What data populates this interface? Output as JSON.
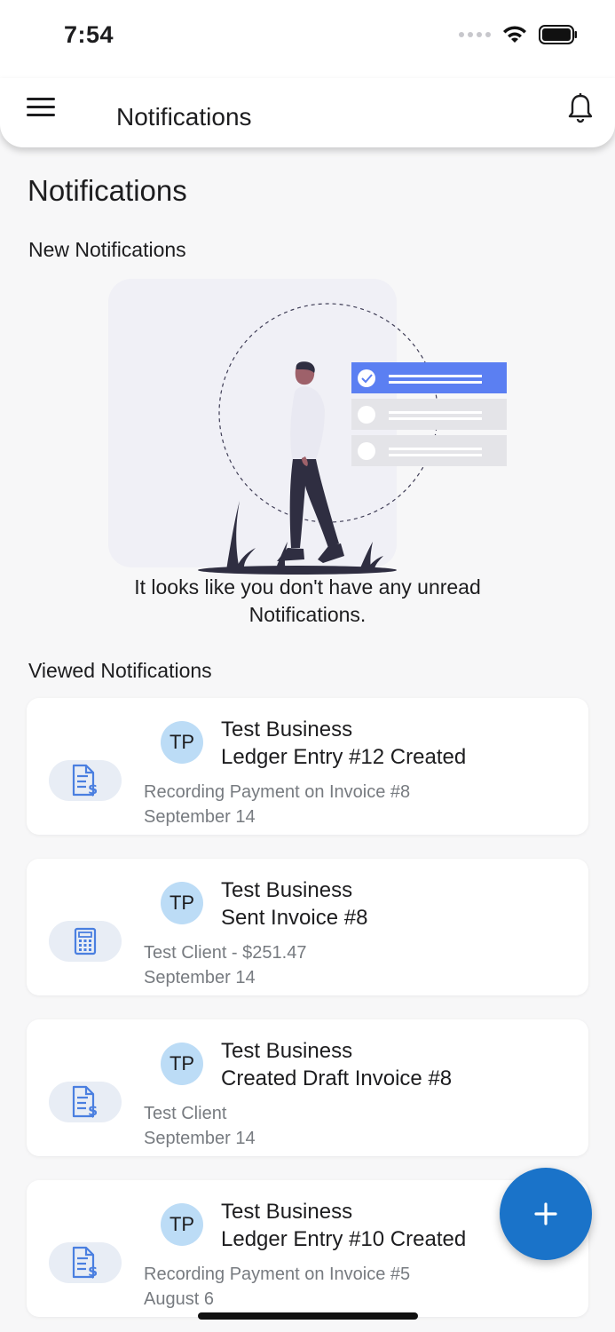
{
  "status_bar": {
    "time": "7:54"
  },
  "app_bar": {
    "title": "Notifications",
    "menu_icon": "menu-icon",
    "bell_icon": "bell-icon"
  },
  "page": {
    "title": "Notifications",
    "new_section_label": "New Notifications",
    "empty_message_line1": "It looks like you don't have any unread",
    "empty_message_line2": "Notifications.",
    "viewed_section_label": "Viewed Notifications"
  },
  "notifications": [
    {
      "icon": "invoice-dollar-icon",
      "avatar": "TP",
      "business": "Test Business",
      "action": "Ledger Entry #12 Created",
      "subtitle": "Recording Payment on Invoice #8",
      "date": "September 14"
    },
    {
      "icon": "calculator-icon",
      "avatar": "TP",
      "business": "Test Business",
      "action": "Sent Invoice #8",
      "subtitle": "Test Client - $251.47",
      "date": "September 14"
    },
    {
      "icon": "invoice-dollar-icon",
      "avatar": "TP",
      "business": "Test Business",
      "action": "Created Draft Invoice #8",
      "subtitle": "Test Client",
      "date": "September 14"
    },
    {
      "icon": "invoice-dollar-icon",
      "avatar": "TP",
      "business": "Test Business",
      "action": "Ledger Entry #10 Created",
      "subtitle": "Recording Payment on Invoice #5",
      "date": "August 6"
    }
  ],
  "fab": {
    "icon": "plus-icon"
  },
  "colors": {
    "accent": "#1a73c9",
    "icon_blue": "#4a7fe0",
    "avatar_bg": "#bcdcf6",
    "illustration_bar": "#5b7ff2"
  }
}
